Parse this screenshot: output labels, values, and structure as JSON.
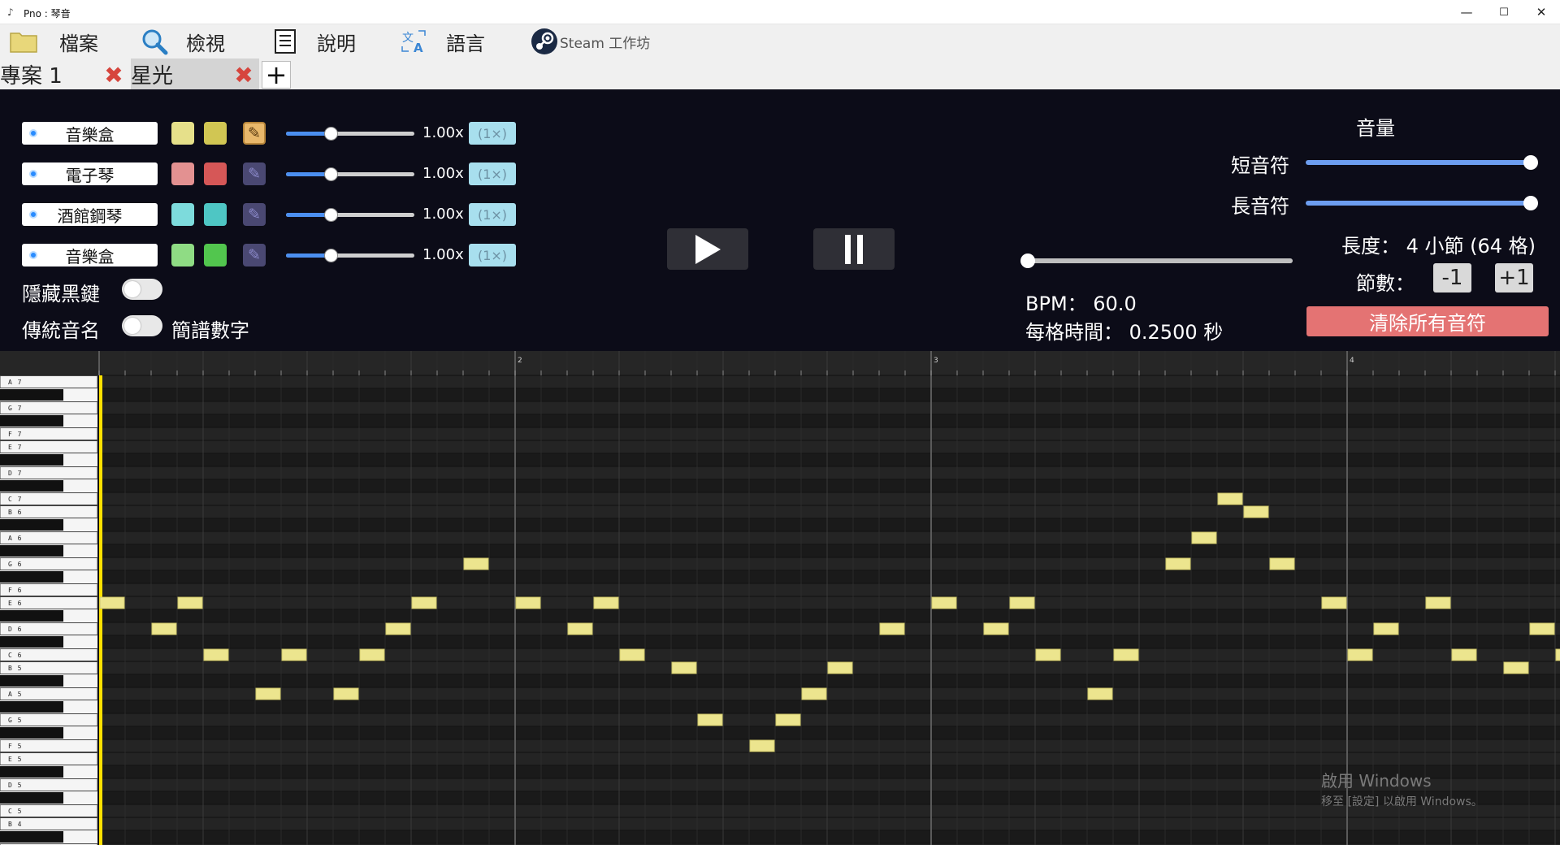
{
  "window": {
    "title": "Pno : 琴音",
    "minimize": "—",
    "maximize": "☐",
    "close": "✕"
  },
  "menu": {
    "file": "檔案",
    "view": "檢視",
    "help": "說明",
    "language": "語言",
    "steam": "Steam 工作坊"
  },
  "tabs": [
    {
      "label": "專案 1",
      "active": false
    },
    {
      "label": "星光",
      "active": true
    }
  ],
  "tab_close_glyph": "✖",
  "add_tab_glyph": "+",
  "tracks": [
    {
      "instrument": "音樂盒",
      "color_light": "#e6e08a",
      "color_dark": "#d1c653",
      "pencil_active": true,
      "speed": "1.00x",
      "multiplier": "(1×)",
      "speed_fraction": 0.35
    },
    {
      "instrument": "電子琴",
      "color_light": "#e39191",
      "color_dark": "#d65757",
      "pencil_active": false,
      "speed": "1.00x",
      "multiplier": "(1×)",
      "speed_fraction": 0.35
    },
    {
      "instrument": "酒館鋼琴",
      "color_light": "#7ddbdc",
      "color_dark": "#4ec6c4",
      "pencil_active": false,
      "speed": "1.00x",
      "multiplier": "(1×)",
      "speed_fraction": 0.35
    },
    {
      "instrument": "音樂盒",
      "color_light": "#8fdc84",
      "color_dark": "#52c64e",
      "pencil_active": false,
      "speed": "1.00x",
      "multiplier": "(1×)",
      "speed_fraction": 0.35
    }
  ],
  "toggles": {
    "hide_black_keys": "隱藏黑鍵",
    "traditional_names": "傳統音名",
    "numbered_notation": "簡譜數字"
  },
  "volume": {
    "title": "音量",
    "short_note": "短音符",
    "long_note": "長音符",
    "short_level": 1.0,
    "long_level": 1.0
  },
  "bpm_text": "BPM： 60.0",
  "cell_time_text": "每格時間： 0.2500 秒",
  "bpm_fraction": 0.0,
  "length_text": "長度： 4 小節 (64 格)",
  "measures_label": "節數：",
  "minus_one": "-1",
  "plus_one": "+1",
  "clear_all": "清除所有音符",
  "roll": {
    "measure_markers": [
      "2",
      "3",
      "4"
    ],
    "key_labels": [
      "A7",
      "G7",
      "F7",
      "E7",
      "D7",
      "C7",
      "B6",
      "A6",
      "G6",
      "F6",
      "E6",
      "D6",
      "C6",
      "B5",
      "A5",
      "G5",
      "F5",
      "E5",
      "D5",
      "C5",
      "B4"
    ],
    "note_color": "#ece58e",
    "notes": [
      {
        "step": 0,
        "pitch": "E6"
      },
      {
        "step": 2,
        "pitch": "D6"
      },
      {
        "step": 3,
        "pitch": "E6"
      },
      {
        "step": 4,
        "pitch": "C6"
      },
      {
        "step": 6,
        "pitch": "A5"
      },
      {
        "step": 7,
        "pitch": "C6"
      },
      {
        "step": 9,
        "pitch": "A5"
      },
      {
        "step": 10,
        "pitch": "C6"
      },
      {
        "step": 11,
        "pitch": "D6"
      },
      {
        "step": 12,
        "pitch": "E6"
      },
      {
        "step": 14,
        "pitch": "G6"
      },
      {
        "step": 16,
        "pitch": "E6"
      },
      {
        "step": 18,
        "pitch": "D6"
      },
      {
        "step": 19,
        "pitch": "E6"
      },
      {
        "step": 20,
        "pitch": "C6"
      },
      {
        "step": 22,
        "pitch": "B5"
      },
      {
        "step": 23,
        "pitch": "G5"
      },
      {
        "step": 25,
        "pitch": "F5"
      },
      {
        "step": 26,
        "pitch": "G5"
      },
      {
        "step": 27,
        "pitch": "A5"
      },
      {
        "step": 28,
        "pitch": "B5"
      },
      {
        "step": 30,
        "pitch": "D6"
      },
      {
        "step": 32,
        "pitch": "E6"
      },
      {
        "step": 34,
        "pitch": "D6"
      },
      {
        "step": 35,
        "pitch": "E6"
      },
      {
        "step": 36,
        "pitch": "C6"
      },
      {
        "step": 38,
        "pitch": "A5"
      },
      {
        "step": 39,
        "pitch": "C6"
      },
      {
        "step": 41,
        "pitch": "G6"
      },
      {
        "step": 42,
        "pitch": "A6"
      },
      {
        "step": 43,
        "pitch": "C7"
      },
      {
        "step": 44,
        "pitch": "B6"
      },
      {
        "step": 45,
        "pitch": "G6"
      },
      {
        "step": 47,
        "pitch": "E6"
      },
      {
        "step": 48,
        "pitch": "C6"
      },
      {
        "step": 49,
        "pitch": "D6"
      },
      {
        "step": 51,
        "pitch": "E6"
      },
      {
        "step": 52,
        "pitch": "C6"
      },
      {
        "step": 54,
        "pitch": "B5"
      },
      {
        "step": 55,
        "pitch": "D6"
      },
      {
        "step": 56,
        "pitch": "C6"
      }
    ]
  },
  "watermark": {
    "line1": "啟用 Windows",
    "line2": "移至 [設定] 以啟用 Windows。"
  }
}
